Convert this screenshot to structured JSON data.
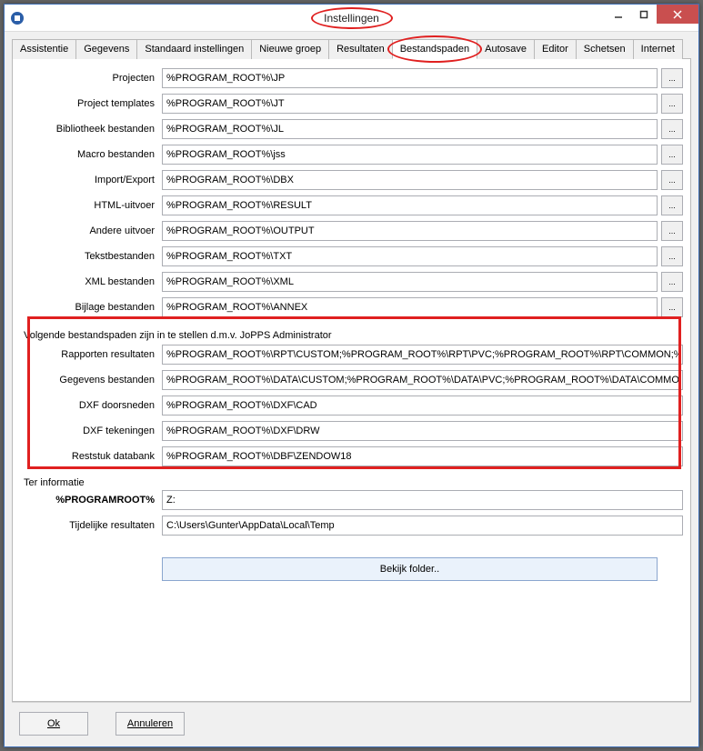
{
  "window": {
    "title": "Instellingen"
  },
  "tabs": [
    {
      "id": "assistentie",
      "label": "Assistentie"
    },
    {
      "id": "gegevens",
      "label": "Gegevens"
    },
    {
      "id": "standaard",
      "label": "Standaard instellingen"
    },
    {
      "id": "nieuwe",
      "label": "Nieuwe groep"
    },
    {
      "id": "resultaten",
      "label": "Resultaten"
    },
    {
      "id": "bestandspaden",
      "label": "Bestandspaden"
    },
    {
      "id": "autosave",
      "label": "Autosave"
    },
    {
      "id": "editor",
      "label": "Editor"
    },
    {
      "id": "schetsen",
      "label": "Schetsen"
    },
    {
      "id": "internet",
      "label": "Internet"
    }
  ],
  "active_tab": "bestandspaden",
  "paths": {
    "projecten": {
      "label": "Projecten",
      "value": "%PROGRAM_ROOT%\\JP"
    },
    "templates": {
      "label": "Project templates",
      "value": "%PROGRAM_ROOT%\\JT"
    },
    "bibliotheek": {
      "label": "Bibliotheek bestanden",
      "value": "%PROGRAM_ROOT%\\JL"
    },
    "macro": {
      "label": "Macro bestanden",
      "value": "%PROGRAM_ROOT%\\jss"
    },
    "import": {
      "label": "Import/Export",
      "value": "%PROGRAM_ROOT%\\DBX"
    },
    "html": {
      "label": "HTML-uitvoer",
      "value": "%PROGRAM_ROOT%\\RESULT"
    },
    "andere": {
      "label": "Andere uitvoer",
      "value": "%PROGRAM_ROOT%\\OUTPUT"
    },
    "tekst": {
      "label": "Tekstbestanden",
      "value": "%PROGRAM_ROOT%\\TXT"
    },
    "xml": {
      "label": "XML bestanden",
      "value": "%PROGRAM_ROOT%\\XML"
    },
    "bijlage": {
      "label": "Bijlage bestanden",
      "value": "%PROGRAM_ROOT%\\ANNEX"
    }
  },
  "admin_note": "Volgende bestandspaden zijn in te stellen d.m.v. JoPPS Administrator",
  "admin_paths": {
    "rapporten": {
      "label": "Rapporten resultaten",
      "value": "%PROGRAM_ROOT%\\RPT\\CUSTOM;%PROGRAM_ROOT%\\RPT\\PVC;%PROGRAM_ROOT%\\RPT\\COMMON;%F"
    },
    "gegevens": {
      "label": "Gegevens bestanden",
      "value": "%PROGRAM_ROOT%\\DATA\\CUSTOM;%PROGRAM_ROOT%\\DATA\\PVC;%PROGRAM_ROOT%\\DATA\\COMMON"
    },
    "dxfdoor": {
      "label": "DXF doorsneden",
      "value": "%PROGRAM_ROOT%\\DXF\\CAD"
    },
    "dxftek": {
      "label": "DXF tekeningen",
      "value": "%PROGRAM_ROOT%\\DXF\\DRW"
    },
    "reststuk": {
      "label": "Reststuk databank",
      "value": "%PROGRAM_ROOT%\\DBF\\ZENDOW18"
    }
  },
  "info": {
    "section_label": "Ter informatie",
    "root_label": "%PROGRAMROOT%",
    "root_value": "Z:",
    "temp_label": "Tijdelijke resultaten",
    "temp_value": "C:\\Users\\Gunter\\AppData\\Local\\Temp"
  },
  "bekijk_label": "Bekijk folder..",
  "buttons": {
    "ok": "Ok",
    "cancel": "Annuleren"
  },
  "browse_label": "..."
}
